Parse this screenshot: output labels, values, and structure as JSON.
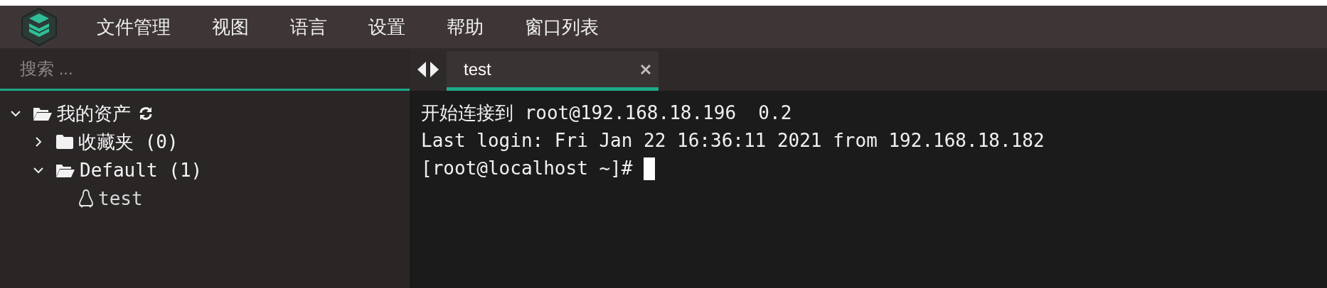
{
  "menu": [
    "文件管理",
    "视图",
    "语言",
    "设置",
    "帮助",
    "窗口列表"
  ],
  "search": {
    "placeholder": "搜索 ..."
  },
  "tree": [
    {
      "label": "我的资产",
      "kind": "root",
      "expanded": true,
      "children": [
        {
          "label": "收藏夹 (0)",
          "kind": "folder",
          "expanded": false
        },
        {
          "label": "Default (1)",
          "kind": "folder",
          "expanded": true,
          "children": [
            {
              "label": "test",
              "kind": "host"
            }
          ]
        }
      ]
    }
  ],
  "tabs": [
    {
      "label": "test",
      "selected": true
    }
  ],
  "terminal": {
    "lines": [
      "开始连接到 root@192.168.18.196  0.2",
      "Last login: Fri Jan 22 16:36:11 2021 from 192.168.18.182"
    ],
    "prompt": "[root@localhost ~]#"
  }
}
